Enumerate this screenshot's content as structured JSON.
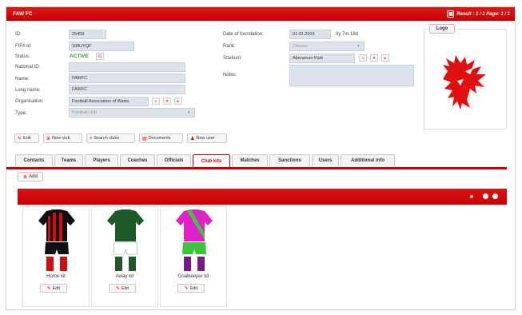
{
  "header": {
    "title": "FAW FC",
    "pager_text": "Result : 1 / 1 Page: 1 / 1",
    "pager_icon": "grid-icon"
  },
  "form": {
    "id_label": "ID:",
    "id_value": "25459",
    "fifa_label": "FIFA Id:",
    "fifa_value": "108UYQF",
    "status_label": "Status:",
    "status_value": "ACTIVE",
    "national_label": "National ID:",
    "national_value": "",
    "name_label": "Name:",
    "name_value": "FAWFC",
    "long_name_label": "Long name:",
    "long_name_value": "FAWFC",
    "organisation_label": "Organisation:",
    "organisation_value": "Football Association of Wales",
    "type_label": "Type:",
    "type_placeholder": "Football club",
    "foundation_label": "Date of foundation:",
    "foundation_value": "01.01.2019",
    "foundation_age": "3y 7m 18d",
    "rank_label": "Rank:",
    "rank_placeholder": "Choose",
    "stadium_label": "Stadium:",
    "stadium_value": "Aberaman Park",
    "notes_label": "Notes:",
    "notes_value": ""
  },
  "logo": {
    "button_label": "Logo",
    "image": "welsh-dragon-logo"
  },
  "actions": [
    {
      "label": "Edit",
      "icon": "pencil-icon"
    },
    {
      "label": "New club",
      "icon": "add-icon"
    },
    {
      "label": "Search clubs",
      "icon": "search-icon"
    },
    {
      "label": "Documents",
      "icon": "document-icon"
    },
    {
      "label": "New user",
      "icon": "user-icon"
    }
  ],
  "tabs": [
    {
      "label": "Contacts"
    },
    {
      "label": "Teams"
    },
    {
      "label": "Players"
    },
    {
      "label": "Coaches"
    },
    {
      "label": "Officials"
    },
    {
      "label": "Club kits"
    },
    {
      "label": "Matches"
    },
    {
      "label": "Sanctions"
    },
    {
      "label": "Users"
    },
    {
      "label": "Additional info"
    }
  ],
  "active_tab": "Club kits",
  "kits_panel": {
    "add_label": "Add",
    "kits": [
      {
        "name": "Home kit",
        "edit_label": "Edit",
        "shirt": "#111111",
        "stripe": "#d01010",
        "shorts": "#111111",
        "socks": "#d01010"
      },
      {
        "name": "Away kit",
        "edit_label": "Edit",
        "shirt": "#1f5a2a",
        "stripe": "#1f5a2a",
        "shorts": "#ffffff",
        "socks": "#1f5a2a"
      },
      {
        "name": "Goalkeeper kit",
        "edit_label": "Edit",
        "shirt": "#e020c8",
        "stripe": "#3cc43c",
        "shorts": "#3cc43c",
        "socks": "#7a1a8a"
      }
    ]
  },
  "colors": {
    "accent": "#c40000",
    "active_status": "#2a9a2a"
  }
}
